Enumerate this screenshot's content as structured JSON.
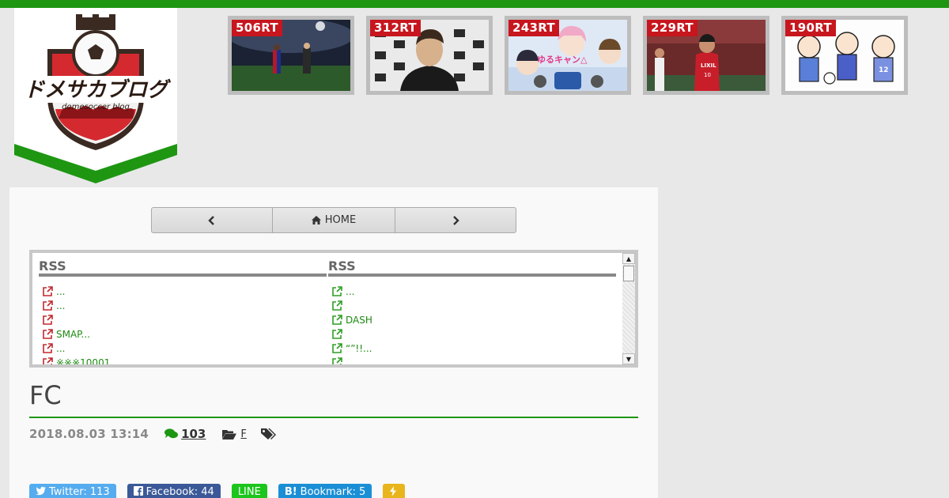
{
  "header": {
    "logo_text": "ドメサカブログ",
    "logo_subtext": "domesoccer blog"
  },
  "popular": [
    {
      "rt": "506RT"
    },
    {
      "rt": "312RT"
    },
    {
      "rt": "243RT"
    },
    {
      "rt": "229RT"
    },
    {
      "rt": "190RT"
    }
  ],
  "pager": {
    "home_label": "HOME"
  },
  "rss": {
    "left": {
      "title": "RSS",
      "items": [
        "...",
        "...",
        "",
        "SMAP...",
        "...",
        "※※※10001"
      ]
    },
    "right": {
      "title": "RSS",
      "items": [
        "...",
        "",
        "DASH",
        "",
        "“”!!...",
        ""
      ]
    }
  },
  "post": {
    "title": "FC",
    "date": "2018.08.03 13:14",
    "comments": "103",
    "category": "F"
  },
  "share": {
    "twitter": "Twitter: 113",
    "facebook": "Facebook: 44",
    "line": "LINE",
    "hatena": "Bookmark: 5",
    "hatena_mark": "B!"
  },
  "colors": {
    "brand_green": "#1e9612",
    "rt_badge": "#c7161e",
    "twitter": "#55acee",
    "facebook": "#3b5998",
    "line": "#1dc51d",
    "hatena": "#1b8fd6",
    "pocket": "#e8b51c"
  }
}
